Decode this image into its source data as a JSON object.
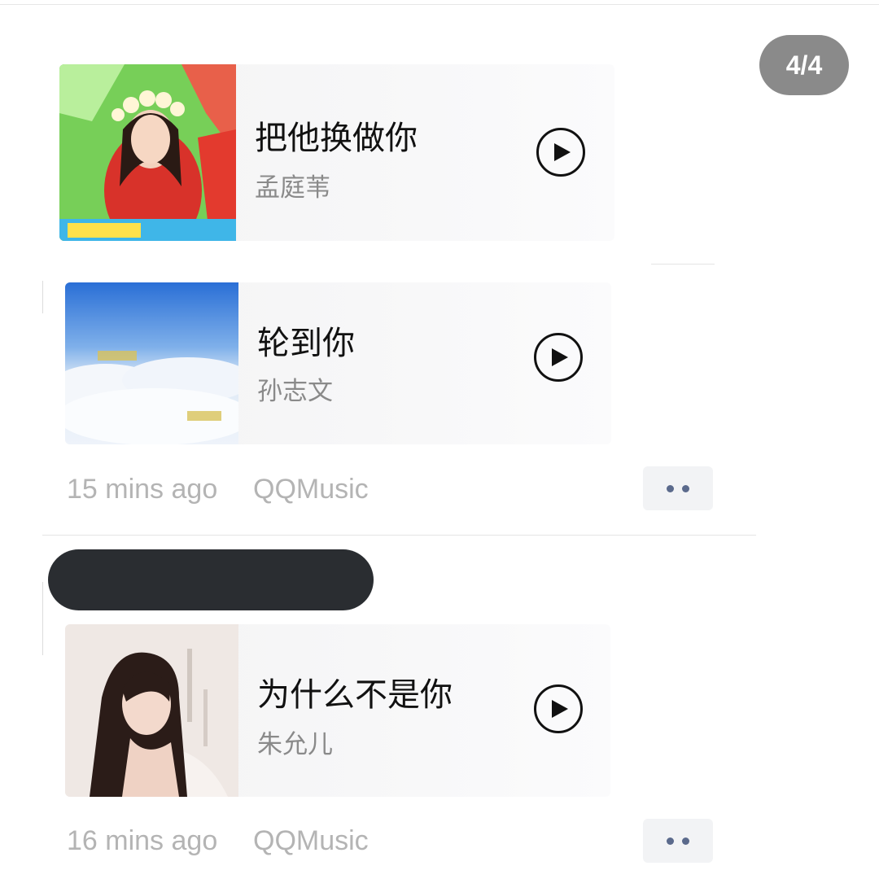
{
  "pager": {
    "label": "4/4"
  },
  "songs": [
    {
      "title": "把他换做你",
      "artist": "孟庭苇"
    },
    {
      "title": "轮到你",
      "artist": "孙志文"
    },
    {
      "title": "为什么不是你",
      "artist": "朱允儿"
    }
  ],
  "posts": [
    {
      "time": "15 mins ago",
      "source": "QQMusic"
    },
    {
      "time": "16 mins ago",
      "source": "QQMusic"
    }
  ],
  "icons": {
    "play": "play-icon",
    "more": "more-dots-icon"
  },
  "colors": {
    "accent_more_dots": "#5b6a8c",
    "pager_bg": "#8a8a8a",
    "redaction": "#2a2d31"
  }
}
